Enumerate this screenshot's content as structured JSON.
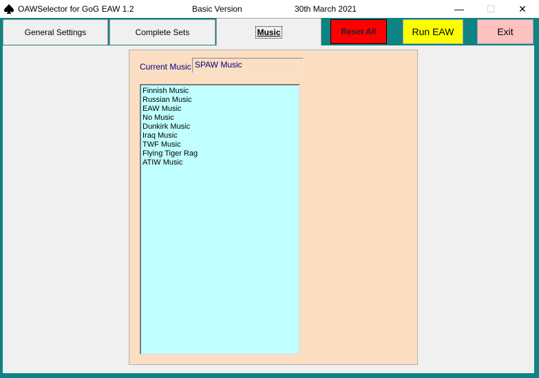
{
  "window": {
    "title": "OAWSelector for GoG EAW 1.2",
    "version": "Basic Version",
    "date": "30th March 2021",
    "minimize_glyph": "—",
    "maximize_glyph": "☐",
    "close_glyph": "✕"
  },
  "tabs": [
    {
      "label": "General Settings",
      "active": false
    },
    {
      "label": "Complete Sets",
      "active": false
    },
    {
      "label": "Music",
      "active": true
    }
  ],
  "buttons": {
    "reset": "Reset All",
    "run": "Run EAW",
    "exit": "Exit"
  },
  "colors": {
    "frame": "#0e8383",
    "panel": "#fcdec2",
    "listbox": "#c0ffff",
    "reset": "#ff0000",
    "run": "#ffff00",
    "exit": "#ffc0c0",
    "label_text": "#000080"
  },
  "music": {
    "current_label": "Current Music",
    "current_value": "SPAW Music",
    "options": [
      "Finnish Music",
      "Russian Music",
      "EAW Music",
      "No Music",
      "Dunkirk Music",
      "Iraq Music",
      "TWF Music",
      "Flying Tiger Rag",
      "ATIW Music"
    ]
  }
}
